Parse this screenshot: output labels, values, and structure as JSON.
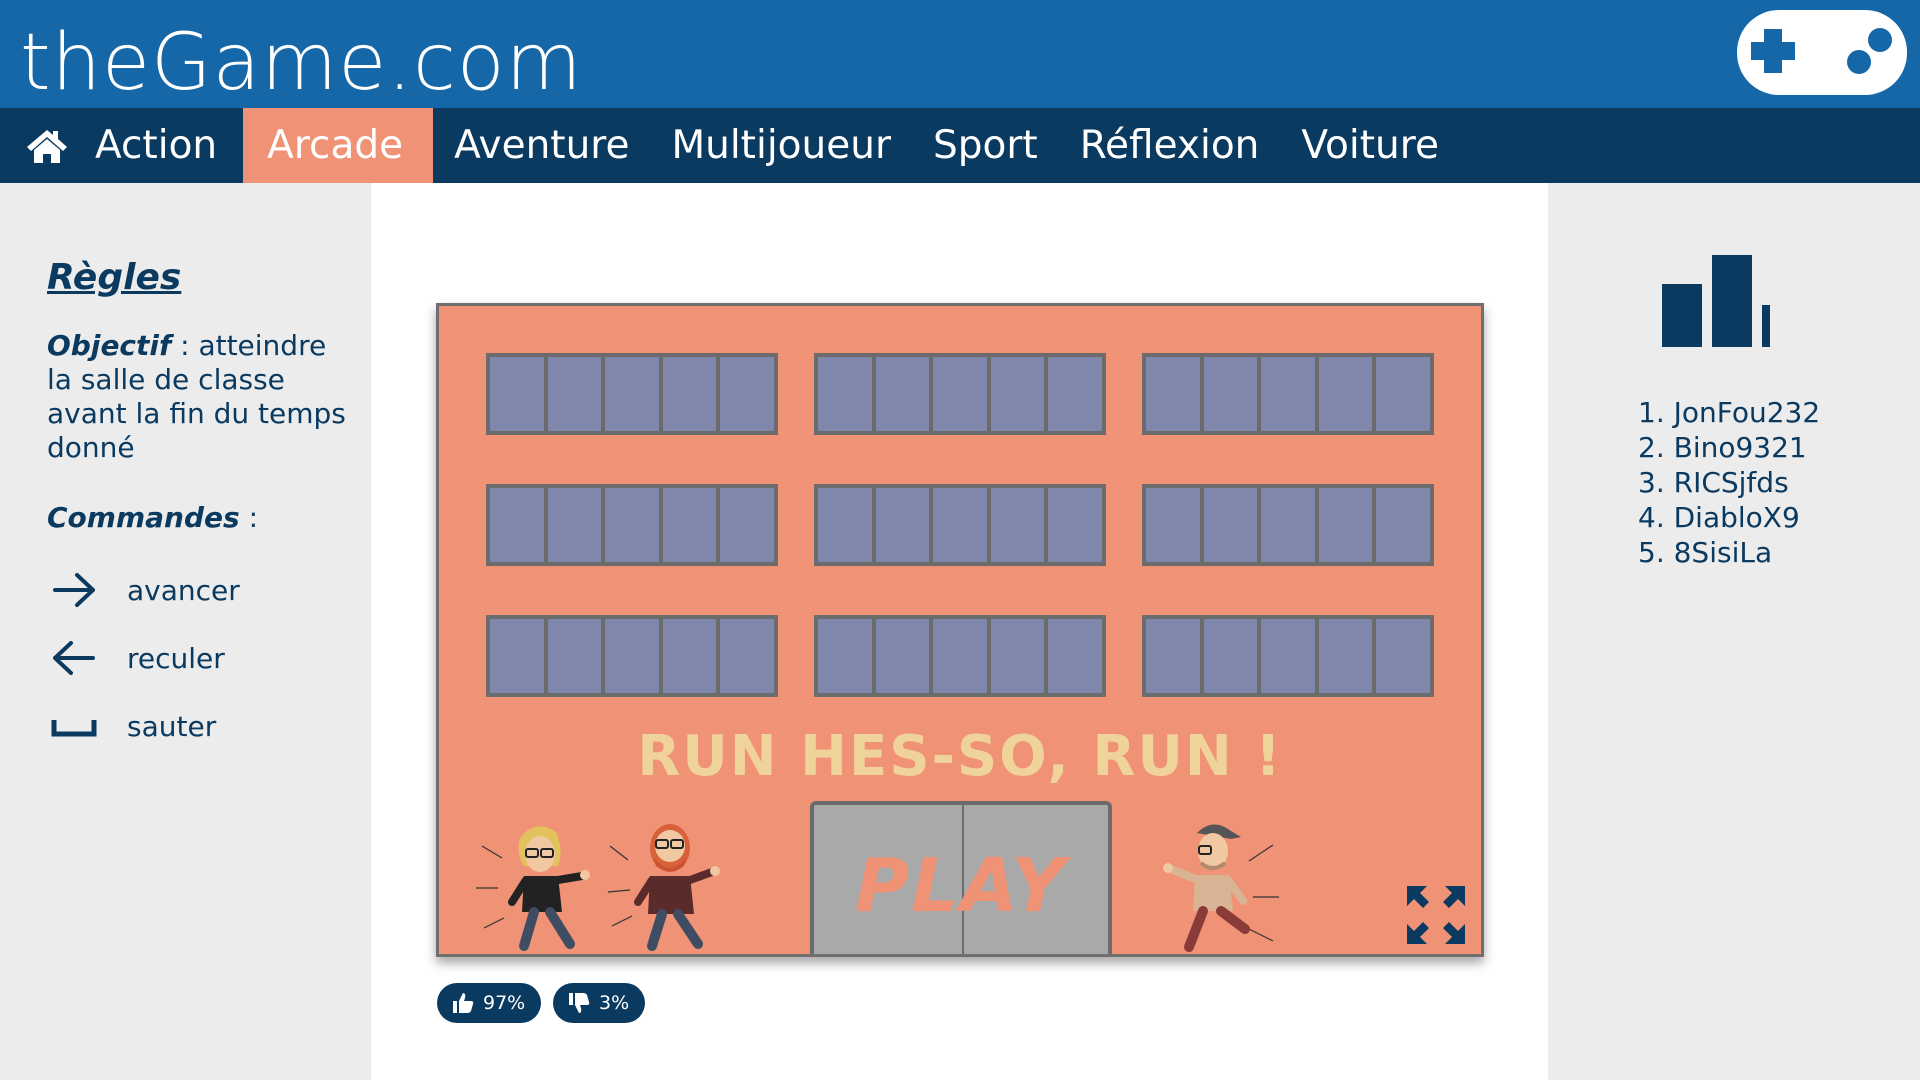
{
  "header": {
    "site_title": "theGame.com",
    "logo_icon": "gamepad-icon"
  },
  "nav": {
    "home_icon": "home-icon",
    "items": [
      {
        "label": "Action"
      },
      {
        "label": "Arcade",
        "active": true
      },
      {
        "label": "Aventure"
      },
      {
        "label": "Multijoueur"
      },
      {
        "label": "Sport"
      },
      {
        "label": "Réflexion"
      },
      {
        "label": "Voiture"
      }
    ]
  },
  "rules": {
    "title": "Règles",
    "objective_label": "Objectif",
    "objective_text": " : atteindre la salle de classe avant la fin du temps donné",
    "commands_label": "Commandes",
    "commands_suffix": " :",
    "commands": [
      {
        "icon": "arrow-right-icon",
        "label": "avancer"
      },
      {
        "icon": "arrow-left-icon",
        "label": "reculer"
      },
      {
        "icon": "spacebar-icon",
        "label": "sauter"
      }
    ]
  },
  "game": {
    "title": "RUN HES-SO, RUN !",
    "play_label": "PLAY",
    "fullscreen_icon": "fullscreen-icon"
  },
  "ratings": {
    "like": "97%",
    "dislike": "3%"
  },
  "leaderboard": {
    "icon": "bar-chart-icon",
    "entries": [
      "1. JonFou232",
      "2. Bino9321",
      "3. RICSjfds",
      "4. DiabloX9",
      "5. 8SisiLa"
    ]
  },
  "colors": {
    "header_bg": "#1667a8",
    "nav_bg": "#0b3a61",
    "accent": "#ef9276",
    "window_glass": "#7f87ad",
    "title_yellow": "#f0d39b"
  }
}
